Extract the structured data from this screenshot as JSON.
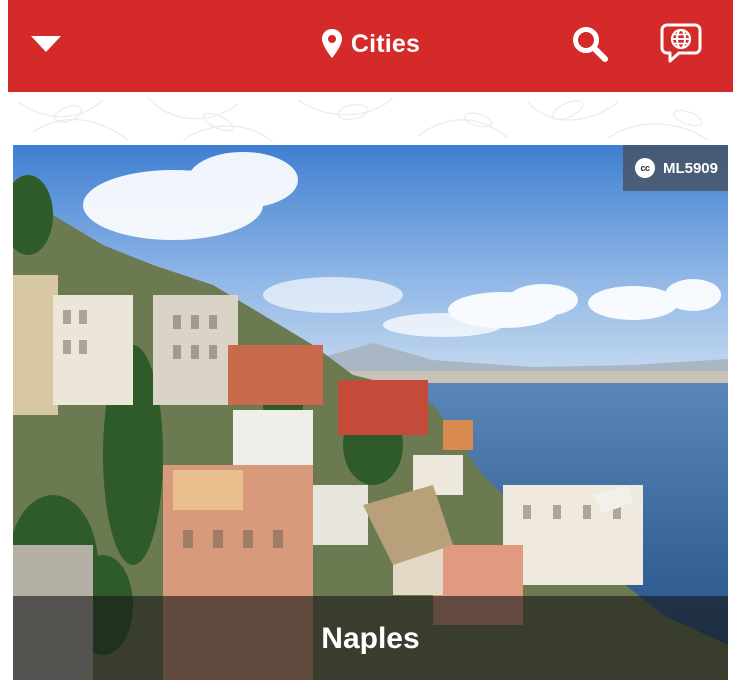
{
  "app_bar": {
    "title": "Cities",
    "background": "#d42a2a",
    "menu_icon": "caret-down-icon",
    "title_icon": "map-pin-icon",
    "search_icon": "search-icon",
    "language_icon": "globe-speech-bubble-icon"
  },
  "city_card": {
    "name": "Naples",
    "photo_credit": "ML5909",
    "credit_icon": "creative-commons-icon",
    "credit_icon_text": "cc"
  }
}
